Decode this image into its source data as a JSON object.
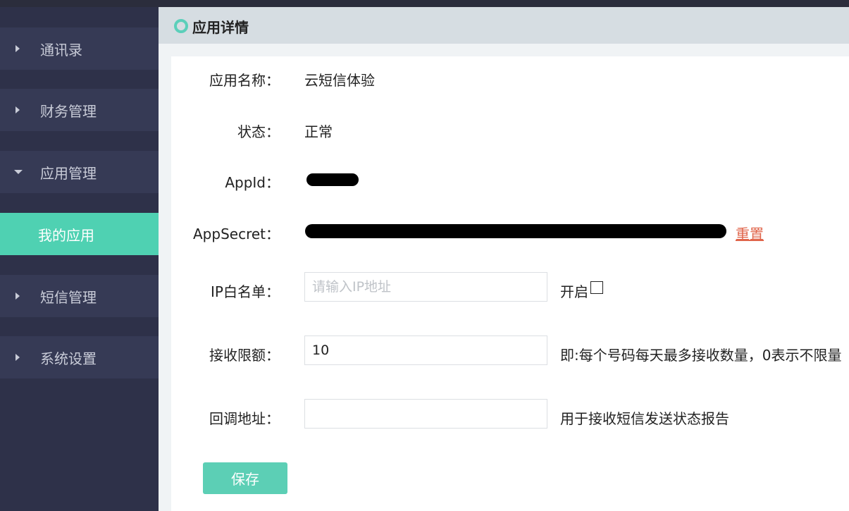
{
  "sidebar": {
    "items": [
      {
        "label": "通讯录"
      },
      {
        "label": "财务管理"
      },
      {
        "label": "应用管理"
      },
      {
        "label": "我的应用"
      },
      {
        "label": "短信管理"
      },
      {
        "label": "系统设置"
      }
    ]
  },
  "header": {
    "title": "应用详情"
  },
  "form": {
    "app_name_label": "应用名称：",
    "app_name_value": "云短信体验",
    "status_label": "状态：",
    "status_value": "正常",
    "appid_label": "AppId：",
    "appsecret_label": "AppSecret：",
    "reset_label": "重置",
    "ip_label": "IP白名单：",
    "ip_placeholder": "请输入IP地址",
    "ip_enable_label": "开启",
    "limit_label": "接收限额：",
    "limit_value": "10",
    "limit_note": "即:每个号码每天最多接收数量，0表示不限量",
    "callback_label": "回调地址：",
    "callback_value": "",
    "callback_note": "用于接收短信发送状态报告",
    "save_label": "保存"
  },
  "colors": {
    "accent": "#4fd1b2",
    "sidebar_bg": "#2e3149",
    "link": "#e0654b"
  }
}
